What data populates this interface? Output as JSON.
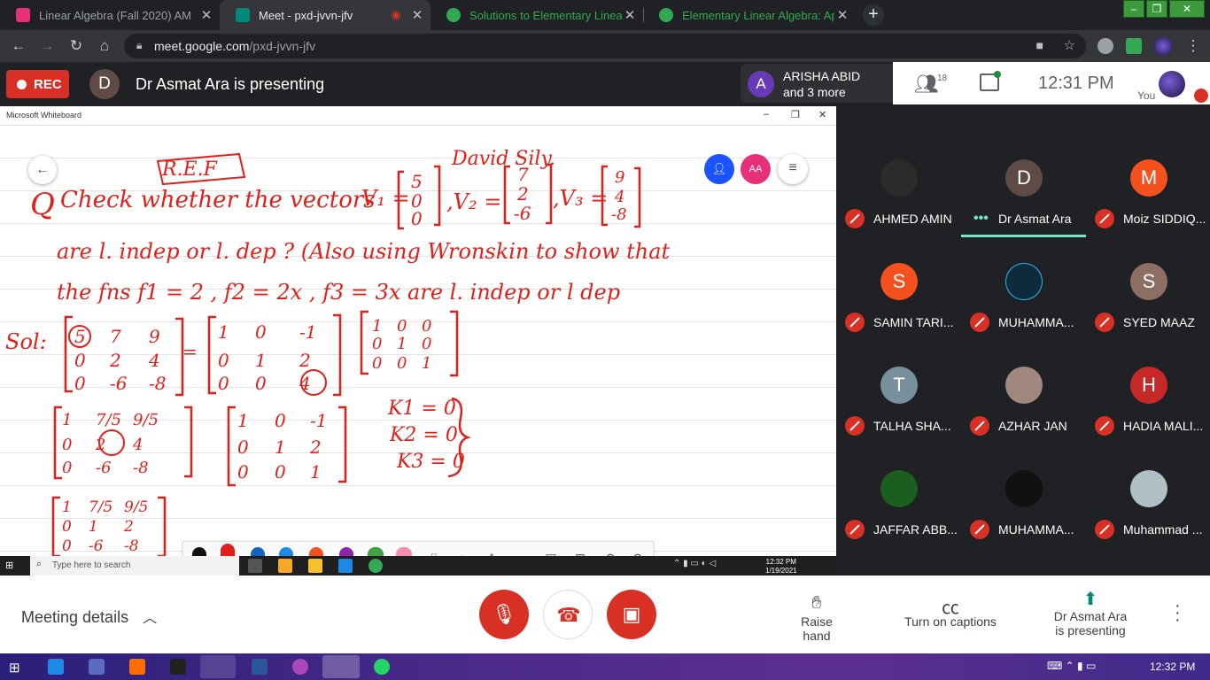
{
  "browser": {
    "tabs": [
      {
        "title": "Linear Algebra (Fall 2020) AM",
        "favicon_color": "#e6317a",
        "active": false
      },
      {
        "title": "Meet - pxd-jvvn-jfv",
        "favicon_color": "#00897b",
        "active": true,
        "recording": true
      },
      {
        "title": "Solutions to Elementary Linear Al",
        "favicon_color": "#34a853",
        "active": false
      },
      {
        "title": "Elementary Linear Algebra: Appli",
        "favicon_color": "#34a853",
        "active": false
      }
    ],
    "new_tab": "+",
    "url_host": "meet.google.com",
    "url_path": "/pxd-jvvn-jfv",
    "window_controls": [
      "–",
      "❐",
      "✕"
    ]
  },
  "meet": {
    "rec_label": "REC",
    "presenter_initial": "D",
    "presenting_text": "Dr Asmat Ara is presenting",
    "raised": {
      "initial": "A",
      "line1": "ARISHA ABID",
      "line2": "and 3 more"
    },
    "participant_count": "18",
    "clock": "12:31 PM",
    "you_label": "You"
  },
  "whiteboard": {
    "app_title": "Microsoft Whiteboard",
    "share_initial": "",
    "user_badge": "AA",
    "ink": {
      "line1_q": "Q",
      "line1_text": "Check whether the vectors",
      "ref_label": "R.E.F",
      "author_note": "David Sily.",
      "v1_label": "V₁ =",
      "v1": [
        "5",
        "0",
        "0"
      ],
      "v2_label": ",V₂ =",
      "v2": [
        "7",
        "2",
        "-6"
      ],
      "v3_label": ",V₃ =",
      "v3": [
        "9",
        "4",
        "-8"
      ],
      "line2": "are l. indep or l. dep ? (Also using Wronskin to show that",
      "line3": "the fns  f1 = 2 ,  f2 = 2x ,  f3 = 3x  are l. indep or l dep",
      "sol_label": "Sol:",
      "m1": [
        [
          "5",
          "7",
          "9"
        ],
        [
          "0",
          "2",
          "4"
        ],
        [
          "0",
          "-6",
          "-8"
        ]
      ],
      "m2": [
        [
          "1",
          "0",
          "-1"
        ],
        [
          "0",
          "1",
          "2"
        ],
        [
          "0",
          "0",
          "4"
        ]
      ],
      "m3": [
        [
          "1",
          "0",
          "0"
        ],
        [
          "0",
          "1",
          "0"
        ],
        [
          "0",
          "0",
          "1"
        ]
      ],
      "m4": [
        [
          "1",
          "7/5",
          "9/5"
        ],
        [
          "0",
          "2",
          "4"
        ],
        [
          "0",
          "-6",
          "-8"
        ]
      ],
      "m5": [
        [
          "1",
          "0",
          "-1"
        ],
        [
          "0",
          "1",
          "2"
        ],
        [
          "0",
          "0",
          "1"
        ]
      ],
      "k_values": [
        "K1 = 0",
        "K2 = 0",
        "K3 = 0"
      ],
      "m6": [
        [
          "1",
          "7/5",
          "9/5"
        ],
        [
          "0",
          "1",
          "2"
        ],
        [
          "0",
          "-6",
          "-8"
        ]
      ]
    }
  },
  "win_taskbar_shared": {
    "search_placeholder": "Type here to search",
    "time": "12:32 PM",
    "date": "1/19/2021"
  },
  "participants": [
    {
      "name": "AHMED AMIN",
      "initial": "",
      "color": "#2b2b2b",
      "muted": true
    },
    {
      "name": "Dr Asmat Ara",
      "initial": "D",
      "color": "#5f4b45",
      "muted": false,
      "speaking": true
    },
    {
      "name": "Moiz SIDDIQ...",
      "initial": "M",
      "color": "#f4511e",
      "muted": true
    },
    {
      "name": "SAMIN TARI...",
      "initial": "S",
      "color": "#f4511e",
      "muted": true
    },
    {
      "name": "MUHAMMA...",
      "initial": "",
      "color": "#0d2b3a",
      "muted": true
    },
    {
      "name": "SYED MAAZ",
      "initial": "S",
      "color": "#8d6e63",
      "muted": true
    },
    {
      "name": "TALHA SHA...",
      "initial": "T",
      "color": "#78909c",
      "muted": true
    },
    {
      "name": "AZHAR JAN",
      "initial": "",
      "color": "#a1887f",
      "muted": true
    },
    {
      "name": "HADIA MALI...",
      "initial": "H",
      "color": "#c62828",
      "muted": true
    },
    {
      "name": "JAFFAR ABB...",
      "initial": "",
      "color": "#1b5e20",
      "muted": true
    },
    {
      "name": "MUHAMMA...",
      "initial": "",
      "color": "#111111",
      "muted": true
    },
    {
      "name": "Muhammad ...",
      "initial": "",
      "color": "#b0bec5",
      "muted": true
    }
  ],
  "controls": {
    "meeting_details": "Meeting details",
    "raise_hand": "Raise hand",
    "captions": "Turn on captions",
    "presenting_line1": "Dr Asmat Ara",
    "presenting_line2": "is presenting"
  },
  "host_taskbar": {
    "time": "12:32 PM"
  },
  "colors": {
    "accent_red": "#d93025",
    "active_speaker": "#74e5c5",
    "ink": "#e0201b"
  }
}
